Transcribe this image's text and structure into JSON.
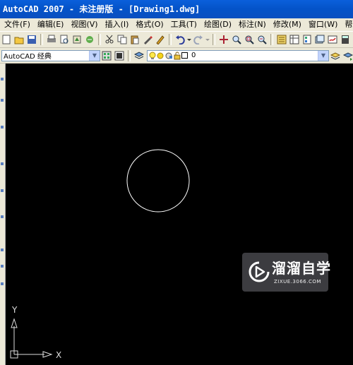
{
  "window": {
    "title": "AutoCAD 2007 - 未注册版 - [Drawing1.dwg]"
  },
  "menu": {
    "items": [
      "文件(F)",
      "编辑(E)",
      "视图(V)",
      "插入(I)",
      "格式(O)",
      "工具(T)",
      "绘图(D)",
      "标注(N)",
      "修改(M)",
      "窗口(W)",
      "帮助(H)"
    ]
  },
  "workspace": {
    "selected": "AutoCAD 经典"
  },
  "layer": {
    "selected": "0"
  },
  "ucs": {
    "x_label": "X",
    "y_label": "Y"
  },
  "watermark": {
    "title": "溜溜自学",
    "subtitle": "ZIXUE.3066.COM"
  },
  "colors": {
    "canvas": "#000000",
    "titlebar": "#0A55D0",
    "circle_stroke": "#FFFFFF",
    "chrome": "#ECE9D8"
  }
}
